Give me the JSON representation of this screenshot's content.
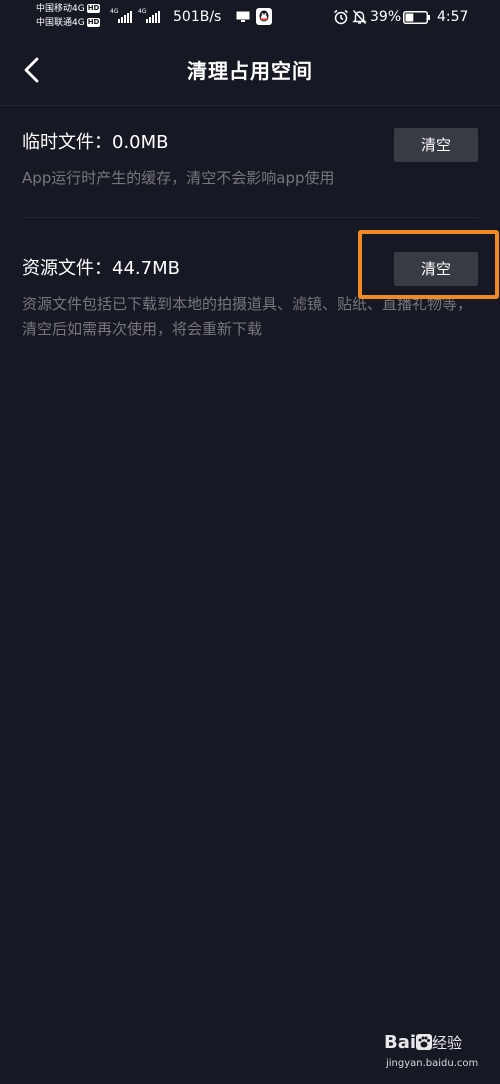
{
  "status_bar": {
    "carrier_1": "中国移动4G",
    "carrier_2": "中国联通4G",
    "hd_badge": "HD",
    "signal_label": "4G",
    "net_speed": "501B/s",
    "battery_percent": "39%",
    "battery_level": 0.39,
    "time": "4:57",
    "icons": [
      "screen-mirror-icon",
      "qq-icon",
      "alarm-icon",
      "mute-bell-icon",
      "battery-icon",
      "signal-icon"
    ]
  },
  "header": {
    "title": "清理占用空间",
    "back_icon": "chevron-left-icon"
  },
  "items": [
    {
      "title": "临时文件：0.0MB",
      "description": "App运行时产生的缓存，清空不会影响app使用",
      "button_label": "清空"
    },
    {
      "title": "资源文件：44.7MB",
      "description": "资源文件包括已下载到本地的拍摄道具、滤镜、贴纸、直播礼物等，清空后如需再次使用，将会重新下载",
      "button_label": "清空"
    }
  ],
  "watermark": {
    "logo_text_1": "Bai",
    "logo_text_2": "经验",
    "url": "jingyan.baidu.com"
  },
  "colors": {
    "background": "#161823",
    "button_bg": "#393b44",
    "desc_text": "#76767c",
    "highlight": "#f08a24"
  }
}
